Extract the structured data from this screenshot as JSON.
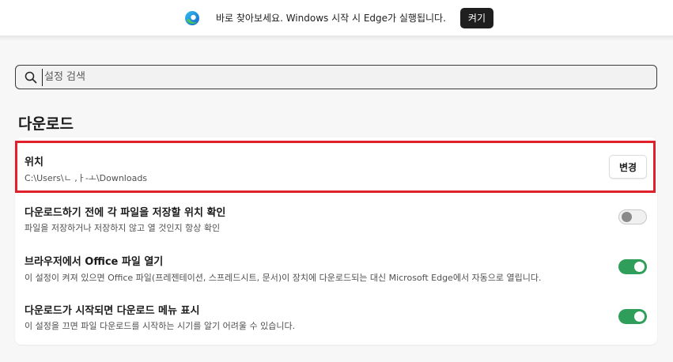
{
  "banner": {
    "icon": "edge-logo-icon",
    "message": "바로 찾아보세요. Windows 시작 시 Edge가 실행됩니다.",
    "button_label": "켜기"
  },
  "search": {
    "placeholder": "설정 검색"
  },
  "section": {
    "title": "다운로드"
  },
  "settings": {
    "location": {
      "title": "위치",
      "path": "C:\\Users\\ㄴ ,ㅏ-ㅗ\\Downloads",
      "button_label": "변경",
      "highlight_color": "#e0202a"
    },
    "ask_location": {
      "title": "다운로드하기 전에 각 파일을 저장할 위치 확인",
      "description": "파일을 저장하거나 저장하지 않고 열 것인지 항상 확인",
      "enabled": false
    },
    "open_office": {
      "title": "브라우저에서 Office 파일 열기",
      "description": "이 설정이 켜져 있으면 Office 파일(프레젠테이션, 스프레드시트, 문서)이 장치에 다운로드되는 대신 Microsoft Edge에서 자동으로 열립니다.",
      "enabled": true
    },
    "show_menu": {
      "title": "다운로드가 시작되면 다운로드 메뉴 표시",
      "description": "이 설정을 끄면 파일 다운로드를 시작하는 시기를 알기 어려울 수 있습니다.",
      "enabled": true
    }
  },
  "colors": {
    "toggle_on": "#2f9e5a",
    "toggle_off": "#f0f0f0",
    "banner_button": "#1f1f1f"
  }
}
